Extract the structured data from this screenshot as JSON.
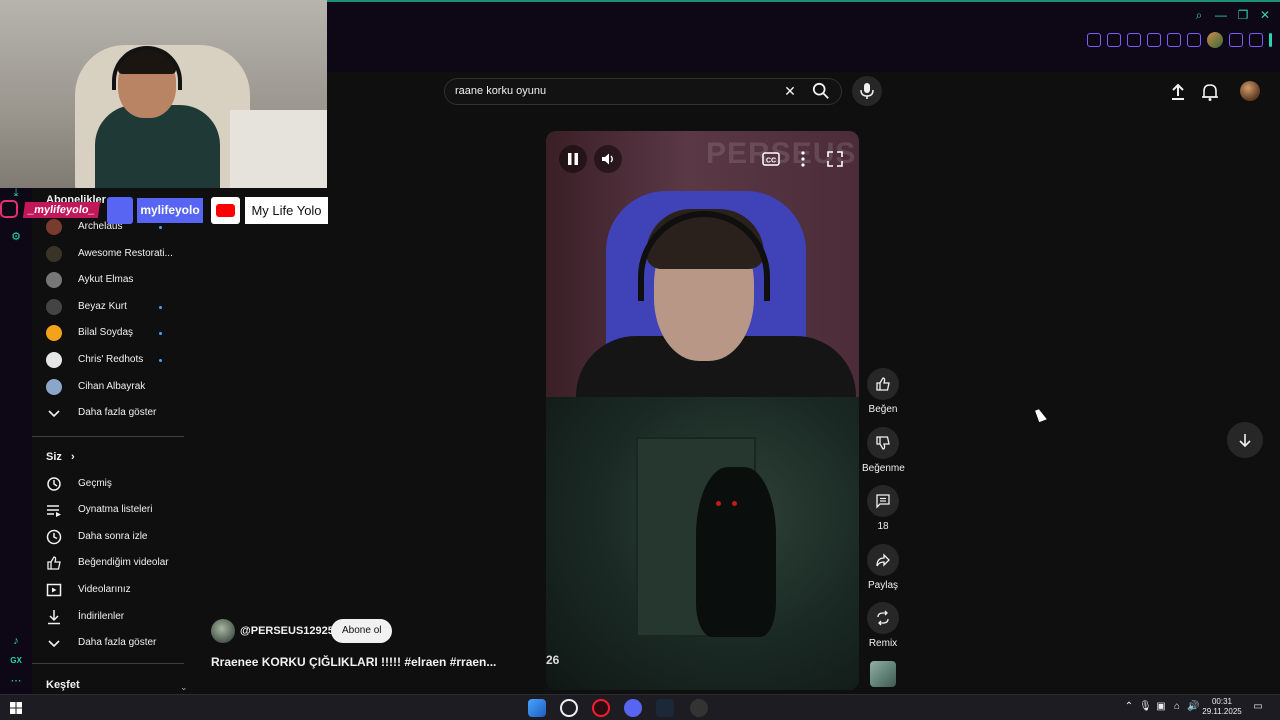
{
  "search": {
    "query": "raane korku oyunu"
  },
  "overlay": {
    "instagram_handle": "_mylifeyolo_",
    "discord_handle": "mylifeyolo",
    "youtube_channel": "My Life Yolo"
  },
  "sidebar": {
    "subscriptions_heading": "Abonelikler",
    "subscriptions": [
      {
        "label": "Archelaus",
        "new": true
      },
      {
        "label": "Awesome Restorati...",
        "new": false
      },
      {
        "label": "Aykut Elmas",
        "new": false
      },
      {
        "label": "Beyaz Kurt",
        "new": true
      },
      {
        "label": "Bilal Soydaş",
        "new": true
      },
      {
        "label": "Chris' Redhots",
        "new": true
      },
      {
        "label": "Cihan Albayrak",
        "new": false
      }
    ],
    "show_more_1": "Daha fazla göster",
    "you_heading": "Siz",
    "you_items": [
      {
        "label": "Geçmiş",
        "icon": "history-icon"
      },
      {
        "label": "Oynatma listeleri",
        "icon": "playlists-icon"
      },
      {
        "label": "Daha sonra izle",
        "icon": "clock-icon"
      },
      {
        "label": "Beğendiğim videolar",
        "icon": "thumbs-up-icon"
      },
      {
        "label": "Videolarınız",
        "icon": "video-icon"
      },
      {
        "label": "İndirilenler",
        "icon": "download-icon"
      }
    ],
    "show_more_2": "Daha fazla göster",
    "explore_heading": "Keşfet"
  },
  "player": {
    "watermark": "PERSEUS",
    "counter": "26"
  },
  "actions": {
    "like_label": "Beğen",
    "dislike_label": "Beğenme",
    "comments_count": "18",
    "share_label": "Paylaş",
    "remix_label": "Remix"
  },
  "short": {
    "channel": "@PERSEUS12925",
    "subscribe_label": "Abone ol",
    "title": "Rraenee KORKU ÇIĞLIKLARI !!!!! #elraen #rraen..."
  },
  "gx": {
    "side_label": "GX"
  },
  "taskbar": {
    "time": "00:31",
    "date": "29.11.2025"
  },
  "colors": {
    "accent_teal": "#2ad4b4",
    "gx_purple": "#7d5cff",
    "youtube_red": "#ff0000",
    "discord_blue": "#5865f2",
    "instagram_pink": "#c2185b"
  }
}
